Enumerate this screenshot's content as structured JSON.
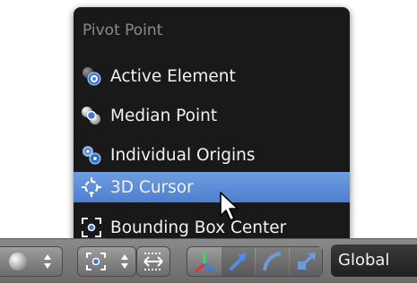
{
  "menu": {
    "title": "Pivot Point",
    "items": [
      {
        "label": "Active Element",
        "icon": "active-element-icon"
      },
      {
        "label": "Median Point",
        "icon": "median-point-icon"
      },
      {
        "label": "Individual Origins",
        "icon": "individual-origins-icon"
      },
      {
        "label": "3D Cursor",
        "icon": "3d-cursor-icon",
        "highlighted": true
      },
      {
        "label": "Bounding Box Center",
        "icon": "bounding-box-center-icon"
      }
    ]
  },
  "header_bar": {
    "viewport_shading_icon": "sphere-icon",
    "pivot_icon": "bounding-box-center-icon",
    "snap_icon": "dotted-arrows-icon",
    "manipulator_icons": [
      "axis-manipulator-icon",
      "translate-arrow-icon",
      "rotate-arc-icon",
      "scale-arrow-icon"
    ],
    "orientation_value": "Global"
  },
  "colors": {
    "menu_bg": "#191919",
    "highlight": "#5b8bd8",
    "title_text": "#8a8a8a",
    "item_text": "#f2f2f2"
  }
}
